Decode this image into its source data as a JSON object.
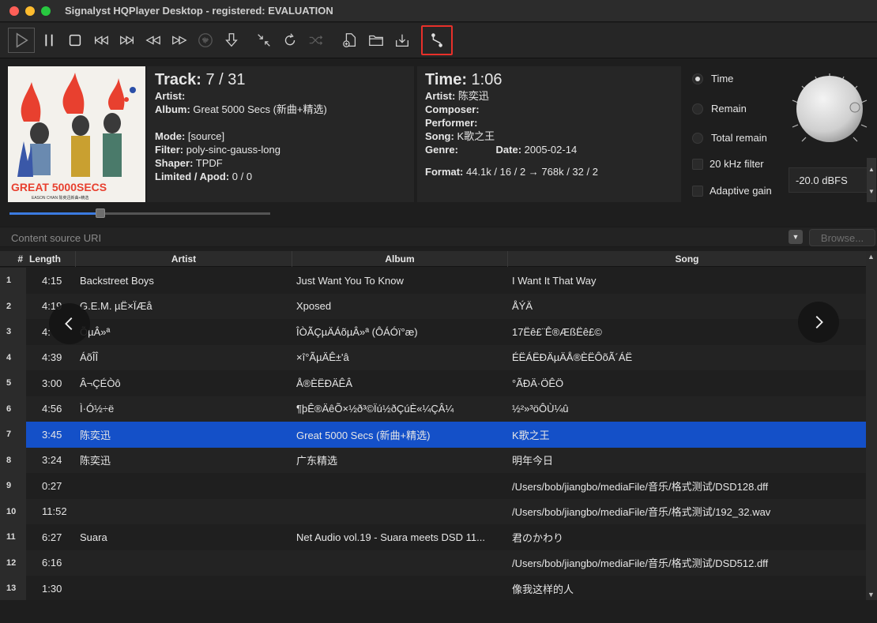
{
  "window": {
    "title": "Signalyst HQPlayer Desktop - registered: EVALUATION"
  },
  "toolbar": {
    "buttons": [
      "play",
      "pause",
      "stop",
      "previous",
      "next",
      "rewind",
      "fast-forward",
      "broadcast",
      "download",
      "collapse",
      "repeat",
      "shuffle",
      "add-file",
      "open-folder",
      "save",
      "transport-route"
    ],
    "highlighted": "transport-route"
  },
  "track": {
    "track_label": "Track:",
    "track_value": "7 / 31",
    "artist_label": "Artist:",
    "artist_value": "",
    "album_label": "Album:",
    "album_value": "Great 5000 Secs (新曲+精选)",
    "mode_label": "Mode:",
    "mode_value": "[source]",
    "filter_label": "Filter:",
    "filter_value": "poly-sinc-gauss-long",
    "shaper_label": "Shaper:",
    "shaper_value": "TPDF",
    "limited_label": "Limited / Apod:",
    "limited_value": "0 / 0"
  },
  "time": {
    "time_label": "Time:",
    "time_value": "1:06",
    "artist_label": "Artist:",
    "artist_value": "陈奕迅",
    "composer_label": "Composer:",
    "composer_value": "",
    "performer_label": "Performer:",
    "performer_value": "",
    "song_label": "Song:",
    "song_value": "K歌之王",
    "genre_label": "Genre:",
    "genre_value": "",
    "date_label": "Date:",
    "date_value": "2005-02-14",
    "format_label": "Format:",
    "format_value": "44.1k / 16 / 2 → 768k / 32 / 2"
  },
  "display_options": {
    "time": "Time",
    "remain": "Remain",
    "total_remain": "Total remain",
    "filter_20khz": "20 kHz filter",
    "adaptive_gain": "Adaptive gain",
    "selected": "time"
  },
  "volume": {
    "value": "-20.0 dBFS"
  },
  "progress": {
    "fraction": 0.3
  },
  "source": {
    "placeholder": "Content source URI",
    "browse_label": "Browse..."
  },
  "album_art": {
    "text": "GREAT 5000SECS",
    "subtext": "EASON CHAN 陈奕迅新曲+精选"
  },
  "playlist": {
    "headers": {
      "num": "#",
      "length": "Length",
      "artist": "Artist",
      "album": "Album",
      "song": "Song"
    },
    "selected_index": 6,
    "rows": [
      {
        "num": "1",
        "length": "4:15",
        "artist": "Backstreet Boys",
        "album": "Just Want You To Know",
        "song": "I Want It That Way"
      },
      {
        "num": "2",
        "length": "4:19",
        "artist": "G.E.M. µË×ÏÆå",
        "album": "Xposed",
        "song": "ÅÝÄ­"
      },
      {
        "num": "3",
        "length": "4:",
        "artist": "ÕµÂ»ª",
        "album": "ÎÒÃÇµÄÁõµÂ»ª (ÔÁÓï°æ)",
        "song": "17Ëê£¨Ê®ÆßËê£©"
      },
      {
        "num": "4",
        "length": "4:39",
        "artist": "ÁõÎÎ",
        "album": "×î°ÃµÄÊ±'â",
        "song": "ÉËÁËÐÄµÄÅ®ÈËÔõÃ´ÁË"
      },
      {
        "num": "5",
        "length": "3:00",
        "artist": "Â¬ÇÉÒô",
        "album": "Å®ÈËÐÄÊÂ",
        "song": "°ÃÐÄ·ÖÊÖ"
      },
      {
        "num": "6",
        "length": "4:56",
        "artist": "Ì·Ó½÷ë",
        "album": "¶þÊ®ÄêÕ×½ð³©Ïú½ðÇúÈ«¼ÇÂ¼",
        "song": "½²»³öÔÙ¼û"
      },
      {
        "num": "7",
        "length": "3:45",
        "artist": "陈奕迅",
        "album": "Great 5000 Secs (新曲+精选)",
        "song": "K歌之王"
      },
      {
        "num": "8",
        "length": "3:24",
        "artist": "陈奕迅",
        "album": "广东精选",
        "song": "明年今日"
      },
      {
        "num": "9",
        "length": "0:27",
        "artist": "",
        "album": "",
        "song": "/Users/bob/jiangbo/mediaFile/音乐/格式测试/DSD128.dff"
      },
      {
        "num": "10",
        "length": "11:52",
        "artist": "",
        "album": "",
        "song": "/Users/bob/jiangbo/mediaFile/音乐/格式测试/192_32.wav"
      },
      {
        "num": "11",
        "length": "6:27",
        "artist": "Suara",
        "album": "Net Audio vol.19 - Suara meets DSD 11...",
        "song": "君のかわり"
      },
      {
        "num": "12",
        "length": "6:16",
        "artist": "",
        "album": "",
        "song": "/Users/bob/jiangbo/mediaFile/音乐/格式测试/DSD512.dff"
      },
      {
        "num": "13",
        "length": "1:30",
        "artist": "",
        "album": "",
        "song": "像我这样的人"
      }
    ]
  }
}
